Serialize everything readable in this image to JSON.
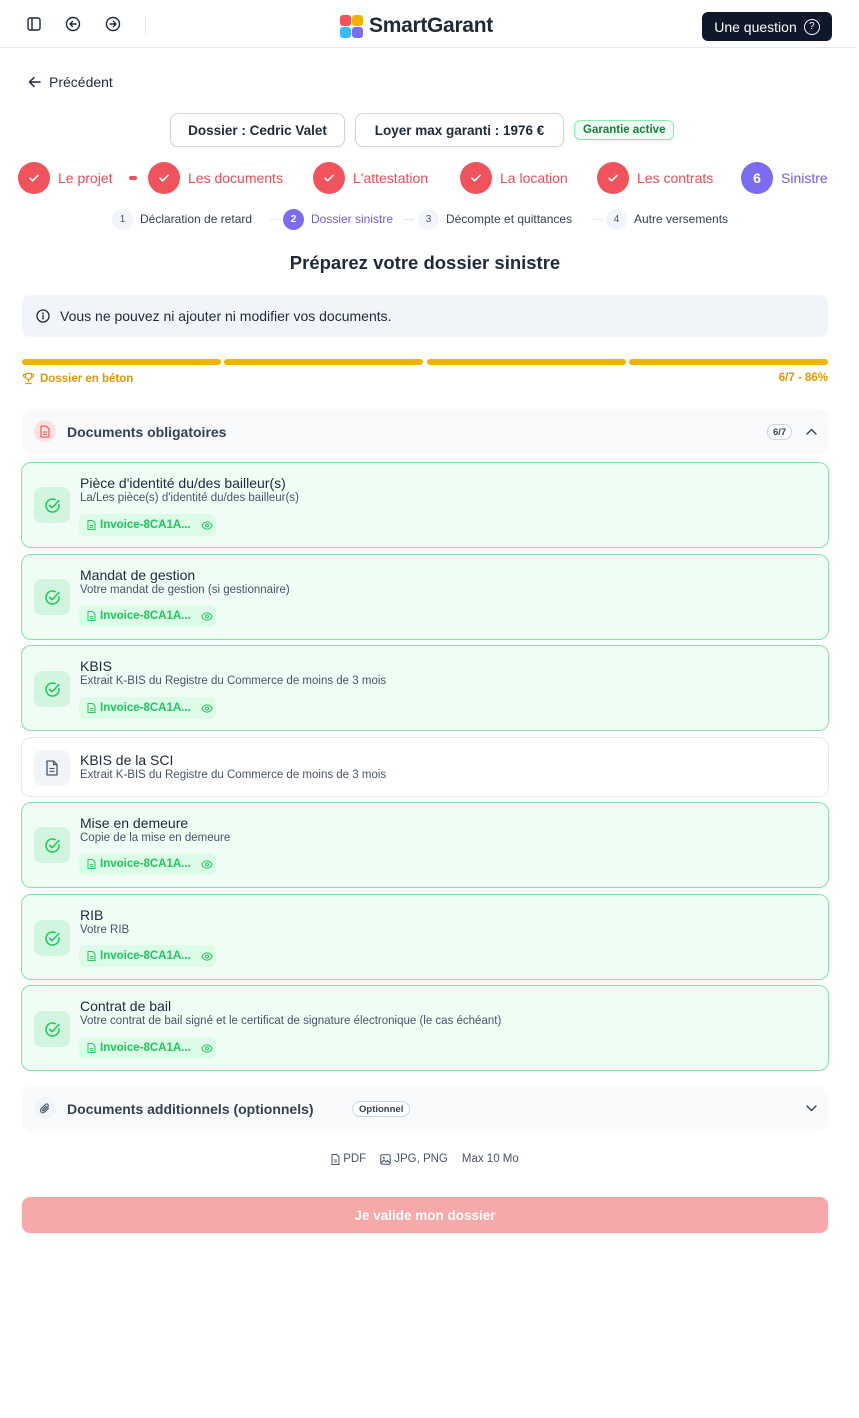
{
  "topbar": {
    "brand": "SmartGarant",
    "question_label": "Une question",
    "question_icon": "?"
  },
  "back_label": "Précédent",
  "info": {
    "dossier": "Dossier : Cedric Valet",
    "loyer": "Loyer max garanti : 1976 €",
    "status": "Garantie active"
  },
  "steps": [
    {
      "label": "Le projet",
      "done": true
    },
    {
      "label": "Les documents",
      "done": true
    },
    {
      "label": "L'attestation",
      "done": true
    },
    {
      "label": "La location",
      "done": true
    },
    {
      "label": "Les contrats",
      "done": true
    },
    {
      "label": "Sinistre",
      "number": "6",
      "done": false
    }
  ],
  "substeps": [
    {
      "number": "1",
      "label": "Déclaration de retard"
    },
    {
      "number": "2",
      "label": "Dossier sinistre"
    },
    {
      "number": "3",
      "label": "Décompte et quittances"
    },
    {
      "number": "4",
      "label": "Autre versements"
    }
  ],
  "heading": "Préparez votre dossier sinistre",
  "alert": "Vous ne pouvez ni ajouter ni modifier vos documents.",
  "progress": {
    "label": "Dossier en béton",
    "summary": "6/7 - 86%",
    "segments_filled": 4,
    "segments_total": 4,
    "color": "#f0b400"
  },
  "required_section": {
    "title": "Documents obligatoires",
    "count": "6/7"
  },
  "documents": [
    {
      "name": "Pièce d'identité du/des bailleur(s)",
      "desc": "La/Les pièce(s) d'identité du/des bailleur(s)",
      "file": "Invoice-8CA1A...",
      "status": "uploaded"
    },
    {
      "name": "Mandat de gestion",
      "desc": "Votre mandat de gestion (si gestionnaire)",
      "file": "Invoice-8CA1A...",
      "status": "uploaded"
    },
    {
      "name": "KBIS",
      "desc": "Extrait K-BIS du Registre du Commerce de moins de 3 mois",
      "file": "Invoice-8CA1A...",
      "status": "uploaded"
    },
    {
      "name": "KBIS de la SCI",
      "desc": "Extrait K-BIS du Registre du Commerce de moins de 3 mois",
      "status": "missing"
    },
    {
      "name": "Mise en demeure",
      "desc": "Copie de la mise en demeure",
      "file": "Invoice-8CA1A...",
      "status": "uploaded"
    },
    {
      "name": "RIB",
      "desc": "Votre RIB",
      "file": "Invoice-8CA1A...",
      "status": "uploaded"
    },
    {
      "name": "Contrat de bail",
      "desc": "Votre contrat de bail signé et le certificat de signature électronique (le cas échéant)",
      "file": "Invoice-8CA1A...",
      "status": "uploaded"
    }
  ],
  "optional_section": {
    "title": "Documents additionnels (optionnels)",
    "badge": "Optionnel"
  },
  "formats": {
    "pdf": "PDF",
    "images": "JPG, PNG",
    "max": "Max 10 Mo"
  },
  "submit_label": "Je valide mon dossier",
  "colors": {
    "accent_red": "#f0535b",
    "accent_purple": "#7c6cf2",
    "success_green": "#22c55e",
    "warning_amber": "#e69500"
  }
}
